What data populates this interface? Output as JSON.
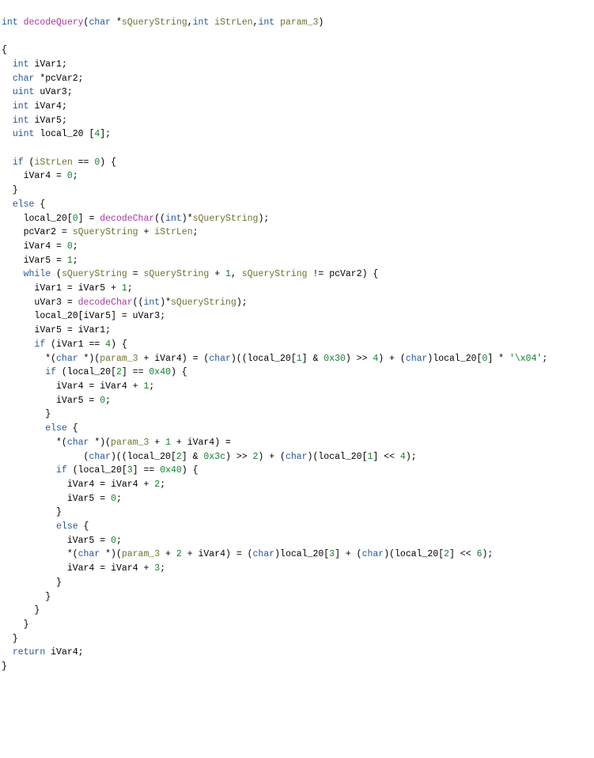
{
  "sig": {
    "ret": "int",
    "name": "decodeQuery",
    "p1t": "char",
    "p1n": "sQueryString",
    "p2t": "int",
    "p2n": "iStrLen",
    "p3t": "int",
    "p3n": "param_3"
  },
  "decl": {
    "t0": "int",
    "n0": "iVar1",
    "t1": "char",
    "n1": "pcVar2",
    "t2": "uint",
    "n2": "uVar3",
    "t3": "int",
    "n3": "iVar4",
    "t4": "int",
    "n4": "iVar5",
    "t5": "uint",
    "n5": "local_20",
    "arr": "4"
  },
  "kw": {
    "if": "if",
    "else": "else",
    "while": "while",
    "return": "return"
  },
  "calls": {
    "dc": "decodeChar"
  },
  "num": {
    "n0": "0",
    "n1": "1",
    "n2": "2",
    "n3": "3",
    "n4": "4",
    "n6": "6",
    "hx30": "0x30",
    "hx40": "0x40",
    "hx3c": "0x3c"
  },
  "lit": {
    "x04": "'\\x04'"
  }
}
